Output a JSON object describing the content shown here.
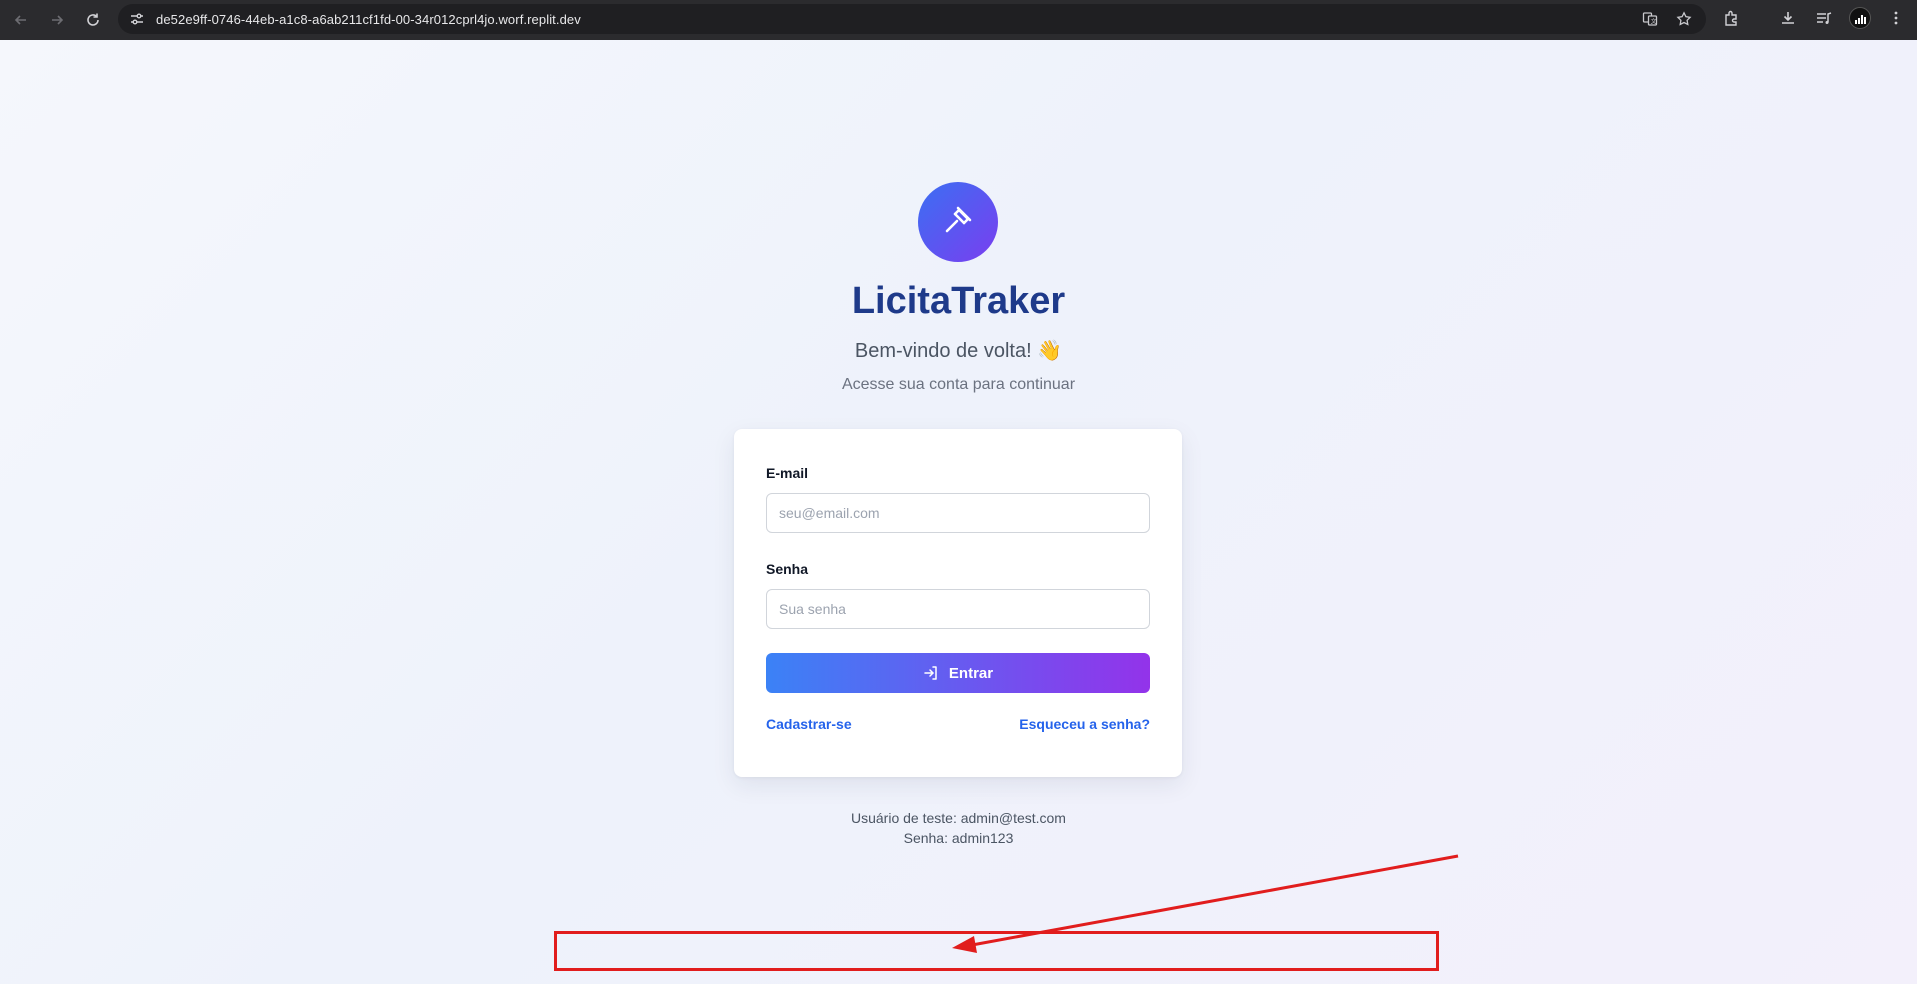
{
  "browser": {
    "url": "de52e9ff-0746-44eb-a1c8-a6ab211cf1fd-00-34r012cprl4jo.worf.replit.dev",
    "back_icon": "arrow-left-icon",
    "forward_icon": "arrow-right-icon",
    "reload_icon": "reload-icon"
  },
  "app": {
    "title": "LicitaTraker",
    "welcome": "Bem-vindo de volta! 👋",
    "subtitle": "Acesse sua conta para continuar",
    "logo_icon": "gavel-icon"
  },
  "form": {
    "email_label": "E-mail",
    "email_placeholder": "seu@email.com",
    "email_value": "",
    "password_label": "Senha",
    "password_placeholder": "Sua senha",
    "password_value": "",
    "submit_label": "Entrar",
    "submit_icon": "login-icon",
    "signup_link": "Cadastrar-se",
    "forgot_link": "Esqueceu a senha?"
  },
  "test_credentials": {
    "user_line": "Usuário de teste: admin@test.com",
    "password_line": "Senha: admin123"
  },
  "colors": {
    "accent_start": "#3b82f6",
    "accent_end": "#9333ea",
    "title": "#1e3a8a",
    "annotation": "#e11d1d"
  }
}
